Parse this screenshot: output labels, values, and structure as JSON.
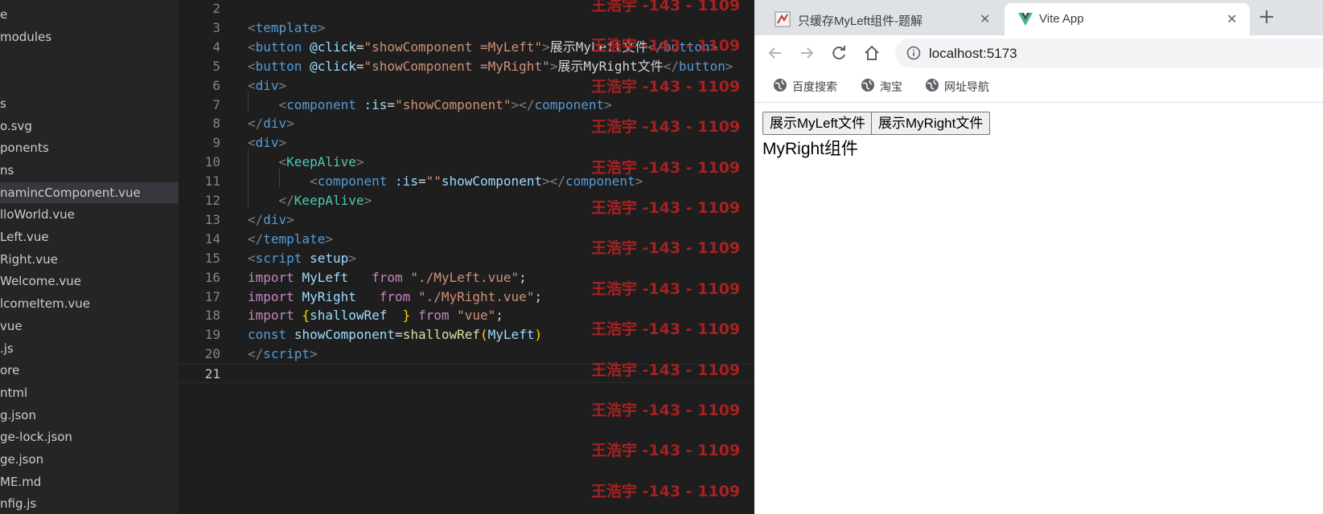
{
  "explorer": {
    "files": [
      "e",
      "modules",
      "",
      "",
      "s",
      "o.svg",
      "ponents",
      "ns",
      "namincComponent.vue",
      "lloWorld.vue",
      "Left.vue",
      "Right.vue",
      "Welcome.vue",
      "lcomeItem.vue",
      "vue",
      ".js",
      "ore",
      "ntml",
      "g.json",
      "ge-lock.json",
      "ge.json",
      "ME.md",
      "nfig.js"
    ]
  },
  "editor": {
    "line_numbers": [
      "2",
      "3",
      "4",
      "5",
      "6",
      "7",
      "8",
      "9",
      "10",
      "11",
      "12",
      "13",
      "14",
      "15",
      "16",
      "17",
      "18",
      "19",
      "20",
      "21"
    ],
    "lines": [
      [],
      [
        [
          "br",
          "<"
        ],
        [
          "tag",
          "template"
        ],
        [
          "br",
          ">"
        ]
      ],
      [
        [
          "br",
          "<"
        ],
        [
          "tag",
          "button"
        ],
        [
          "txt",
          " "
        ],
        [
          "attr",
          "@click"
        ],
        [
          "txt",
          "="
        ],
        [
          "str",
          "\"showComponent =MyLeft\""
        ],
        [
          "br",
          ">"
        ],
        [
          "txt",
          "展示MyLeft文件"
        ],
        [
          "br",
          "</"
        ],
        [
          "tag",
          "button"
        ],
        [
          "br",
          ">"
        ]
      ],
      [
        [
          "br",
          "<"
        ],
        [
          "tag",
          "button"
        ],
        [
          "txt",
          " "
        ],
        [
          "attr",
          "@click"
        ],
        [
          "txt",
          "="
        ],
        [
          "str",
          "\"showComponent =MyRight\""
        ],
        [
          "br",
          ">"
        ],
        [
          "txt",
          "展示MyRight文件"
        ],
        [
          "br",
          "</"
        ],
        [
          "tag",
          "button"
        ],
        [
          "br",
          ">"
        ]
      ],
      [
        [
          "br",
          "<"
        ],
        [
          "tag",
          "div"
        ],
        [
          "br",
          ">"
        ]
      ],
      [
        [
          "txt",
          "    "
        ],
        [
          "br",
          "<"
        ],
        [
          "tag",
          "component"
        ],
        [
          "txt",
          " "
        ],
        [
          "attr",
          ":is"
        ],
        [
          "txt",
          "="
        ],
        [
          "str",
          "\"showComponent\""
        ],
        [
          "br",
          "></"
        ],
        [
          "tag",
          "component"
        ],
        [
          "br",
          ">"
        ]
      ],
      [
        [
          "br",
          "</"
        ],
        [
          "tag",
          "div"
        ],
        [
          "br",
          ">"
        ]
      ],
      [
        [
          "br",
          "<"
        ],
        [
          "tag",
          "div"
        ],
        [
          "br",
          ">"
        ]
      ],
      [
        [
          "txt",
          "    "
        ],
        [
          "br",
          "<"
        ],
        [
          "comp",
          "KeepAlive"
        ],
        [
          "br",
          ">"
        ]
      ],
      [
        [
          "txt",
          "        "
        ],
        [
          "br",
          "<"
        ],
        [
          "tag",
          "component"
        ],
        [
          "txt",
          " "
        ],
        [
          "attr",
          ":is"
        ],
        [
          "txt",
          "="
        ],
        [
          "str",
          "\"\""
        ],
        [
          "attr",
          "showComponent"
        ],
        [
          "br",
          "></"
        ],
        [
          "tag",
          "component"
        ],
        [
          "br",
          ">"
        ]
      ],
      [
        [
          "txt",
          "    "
        ],
        [
          "br",
          "</"
        ],
        [
          "comp",
          "KeepAlive"
        ],
        [
          "br",
          ">"
        ]
      ],
      [
        [
          "br",
          "</"
        ],
        [
          "tag",
          "div"
        ],
        [
          "br",
          ">"
        ]
      ],
      [
        [
          "br",
          "</"
        ],
        [
          "tag",
          "template"
        ],
        [
          "br",
          ">"
        ]
      ],
      [
        [
          "br",
          "<"
        ],
        [
          "tag",
          "script"
        ],
        [
          "txt",
          " "
        ],
        [
          "attr",
          "setup"
        ],
        [
          "br",
          ">"
        ]
      ],
      [
        [
          "kw",
          "import"
        ],
        [
          "txt",
          " "
        ],
        [
          "attr",
          "MyLeft"
        ],
        [
          "txt",
          "   "
        ],
        [
          "kw",
          "from"
        ],
        [
          "txt",
          " "
        ],
        [
          "str",
          "\"./MyLeft.vue\""
        ],
        [
          "txt",
          ";"
        ]
      ],
      [
        [
          "kw",
          "import"
        ],
        [
          "txt",
          " "
        ],
        [
          "attr",
          "MyRight"
        ],
        [
          "txt",
          "   "
        ],
        [
          "kw",
          "from"
        ],
        [
          "txt",
          " "
        ],
        [
          "str",
          "\"./MyRight.vue\""
        ],
        [
          "txt",
          ";"
        ]
      ],
      [
        [
          "kw",
          "import"
        ],
        [
          "txt",
          " "
        ],
        [
          "y",
          "{"
        ],
        [
          "attr",
          "shallowRef"
        ],
        [
          "txt",
          "  "
        ],
        [
          "y",
          "}"
        ],
        [
          "txt",
          " "
        ],
        [
          "kw",
          "from"
        ],
        [
          "txt",
          " "
        ],
        [
          "str",
          "\"vue\""
        ],
        [
          "txt",
          ";"
        ]
      ],
      [
        [
          "tag",
          "const"
        ],
        [
          "txt",
          " "
        ],
        [
          "attr",
          "showComponent"
        ],
        [
          "txt",
          "="
        ],
        [
          "fn",
          "shallowRef"
        ],
        [
          "y",
          "("
        ],
        [
          "attr",
          "MyLeft"
        ],
        [
          "y",
          ")"
        ]
      ],
      [
        [
          "br",
          "</"
        ],
        [
          "tag",
          "script"
        ],
        [
          "br",
          ">"
        ]
      ],
      []
    ],
    "watermark_text": "王浩宇 -143 - 1109"
  },
  "browser": {
    "tabs": [
      {
        "title": "只缓存MyLeft组件-题解",
        "close": "✕"
      },
      {
        "title": "Vite App",
        "close": "✕"
      }
    ],
    "new_tab": "+",
    "url": "localhost:5173",
    "bookmarks": [
      "百度搜索",
      "淘宝",
      "网址导航"
    ],
    "page": {
      "buttons": [
        "展示MyLeft文件",
        "展示MyRight文件"
      ],
      "result": "MyRight组件"
    }
  },
  "colors": {
    "editor_bg": "#1e1e1e",
    "sidebar_bg": "#252526",
    "active_row": "#37373d",
    "watermark": "#b22222",
    "vue_green": "#41b883"
  }
}
